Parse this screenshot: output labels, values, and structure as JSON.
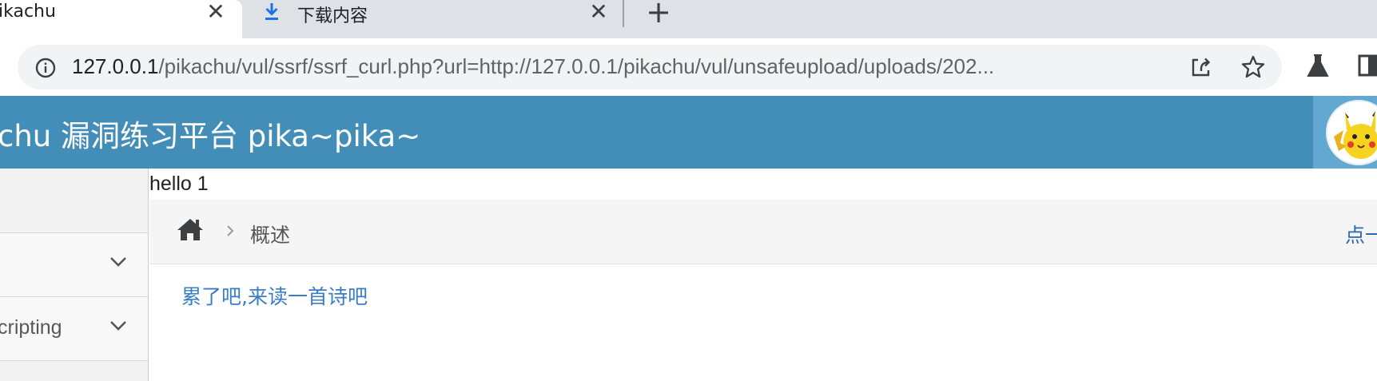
{
  "browser": {
    "tabs": [
      {
        "title": "ikachu"
      },
      {
        "title": "下载内容"
      }
    ],
    "address": {
      "host": "127.0.0.1",
      "path": "/pikachu/vul/ssrf/ssrf_curl.php?url=http://127.0.0.1/pikachu/vul/unsafeupload/uploads/202..."
    }
  },
  "header": {
    "title": "chu 漏洞练习平台 pika~pika~"
  },
  "sidebar": {
    "items": [
      {
        "label": ""
      },
      {
        "label": ""
      },
      {
        "label": "cripting"
      }
    ]
  },
  "main": {
    "echo_text": "hello 1",
    "breadcrumb": {
      "current": "概述",
      "right_link": "点一"
    },
    "poem_link": "累了吧,来读一首诗吧"
  },
  "colors": {
    "header_bg": "#438eb9",
    "avatar_bg": "#62a8d1",
    "link": "#3a7dc4",
    "download_icon": "#1a73e8"
  }
}
